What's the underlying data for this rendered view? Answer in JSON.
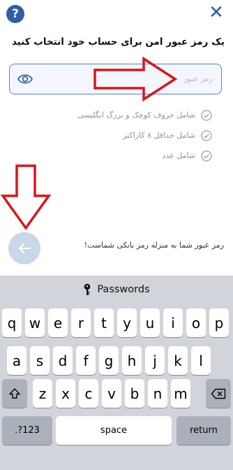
{
  "header": {
    "help_label": "?",
    "close_label": "✕"
  },
  "title": "یک رمز عبور امن برای حساب خود انتخاب کنید",
  "password_field": {
    "placeholder": "رمز عبور",
    "value": ""
  },
  "rules": [
    "شامل حروف کوچک و بزرگ انگلیسی",
    "شامل حداقل ۸ کاراکتر",
    "شامل عدد"
  ],
  "hint": "رمز عبور شما به منزله رمز بانکی شماست!",
  "colors": {
    "accent": "#2f5fa4",
    "field_border": "#4f86d6",
    "annotation_arrow": "#d9161a",
    "back_button": "#c9d7e8"
  },
  "keyboard": {
    "suggestion": "Passwords",
    "row1": [
      "q",
      "w",
      "e",
      "r",
      "t",
      "y",
      "u",
      "i",
      "o",
      "p"
    ],
    "row2": [
      "a",
      "s",
      "d",
      "f",
      "g",
      "h",
      "j",
      "k",
      "l"
    ],
    "row3": [
      "z",
      "x",
      "c",
      "v",
      "b",
      "n",
      "m"
    ],
    "numbers_label": ".?123",
    "space_label": "space",
    "return_label": "return"
  }
}
